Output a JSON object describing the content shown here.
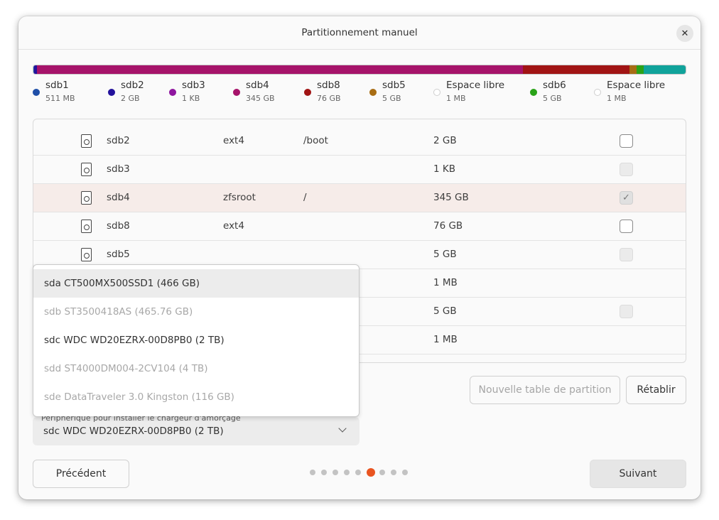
{
  "window": {
    "title": "Partitionnement manuel",
    "close_icon": "close-icon"
  },
  "partition_bar": {
    "segments": [
      {
        "name": "sdb1",
        "color": "#1f4fa8",
        "fraction": 0.001
      },
      {
        "name": "sdb2",
        "color": "#23129c",
        "fraction": 0.004
      },
      {
        "name": "sdb3",
        "color": "#8f169f",
        "fraction": 0.001
      },
      {
        "name": "sdb4",
        "color": "#a6136a",
        "fraction": 0.745
      },
      {
        "name": "sdb8",
        "color": "#a11414",
        "fraction": 0.163
      },
      {
        "name": "sdb5",
        "color": "#a86d14",
        "fraction": 0.011
      },
      {
        "name": "sdb6",
        "color": "#2aa318",
        "fraction": 0.011
      },
      {
        "name": "Espace libre",
        "color": "#10a39b",
        "fraction": 0.064
      }
    ]
  },
  "legend": [
    {
      "name": "sdb1",
      "size": "511 MB",
      "color": "#1f4fa8"
    },
    {
      "name": "sdb2",
      "size": "2 GB",
      "color": "#23129c"
    },
    {
      "name": "sdb3",
      "size": "1 KB",
      "color": "#8f169f"
    },
    {
      "name": "sdb4",
      "size": "345 GB",
      "color": "#a6136a"
    },
    {
      "name": "sdb8",
      "size": "76 GB",
      "color": "#a11414"
    },
    {
      "name": "sdb5",
      "size": "5 GB",
      "color": "#a86d14"
    },
    {
      "name": "Espace libre",
      "size": "1 MB",
      "color": "#ffffff"
    },
    {
      "name": "sdb6",
      "size": "5 GB",
      "color": "#2aa318"
    },
    {
      "name": "Espace libre",
      "size": "1 MB",
      "color": "#ffffff"
    }
  ],
  "table": {
    "rows": [
      {
        "device": "sdb2",
        "type": "ext4",
        "mount": "/boot",
        "size": "2 GB",
        "format": "unchecked",
        "icon": true
      },
      {
        "device": "sdb3",
        "type": "",
        "mount": "",
        "size": "1 KB",
        "format": "disabled",
        "icon": true
      },
      {
        "device": "sdb4",
        "type": "zfsroot",
        "mount": "/",
        "size": "345 GB",
        "format": "checked",
        "icon": true,
        "selected": true
      },
      {
        "device": "sdb8",
        "type": "ext4",
        "mount": "",
        "size": "76 GB",
        "format": "unchecked",
        "icon": true
      },
      {
        "device": "sdb5",
        "type": "",
        "mount": "",
        "size": "5 GB",
        "format": "disabled",
        "icon": true
      },
      {
        "device": "",
        "type": "",
        "mount": "",
        "size": "1 MB",
        "format": "none",
        "icon": false
      },
      {
        "device": "",
        "type": "",
        "mount": "",
        "size": "5 GB",
        "format": "disabled",
        "icon": false
      },
      {
        "device": "",
        "type": "",
        "mount": "",
        "size": "1 MB",
        "format": "none",
        "icon": false
      }
    ]
  },
  "dropdown": {
    "options": [
      {
        "label": "sda CT500MX500SSD1 (466 GB)",
        "state": "highlighted"
      },
      {
        "label": "sdb ST3500418AS (465.76 GB)",
        "state": "disabled"
      },
      {
        "label": "sdc WDC WD20EZRX-00D8PB0 (2 TB)",
        "state": "normal"
      },
      {
        "label": "sdd ST4000DM004-2CV104 (4 TB)",
        "state": "disabled"
      },
      {
        "label": "sde DataTraveler 3.0 Kingston (116 GB)",
        "state": "disabled"
      }
    ]
  },
  "buttons": {
    "new_table": "Nouvelle table de partition",
    "revert": "Rétablir",
    "back": "Précédent",
    "next": "Suivant"
  },
  "bootloader": {
    "label": "Périphérique pour installer le chargeur d'amorçage",
    "value": "sdc WDC WD20EZRX-00D8PB0 (2 TB)"
  },
  "pager": {
    "total": 9,
    "current": 6
  }
}
